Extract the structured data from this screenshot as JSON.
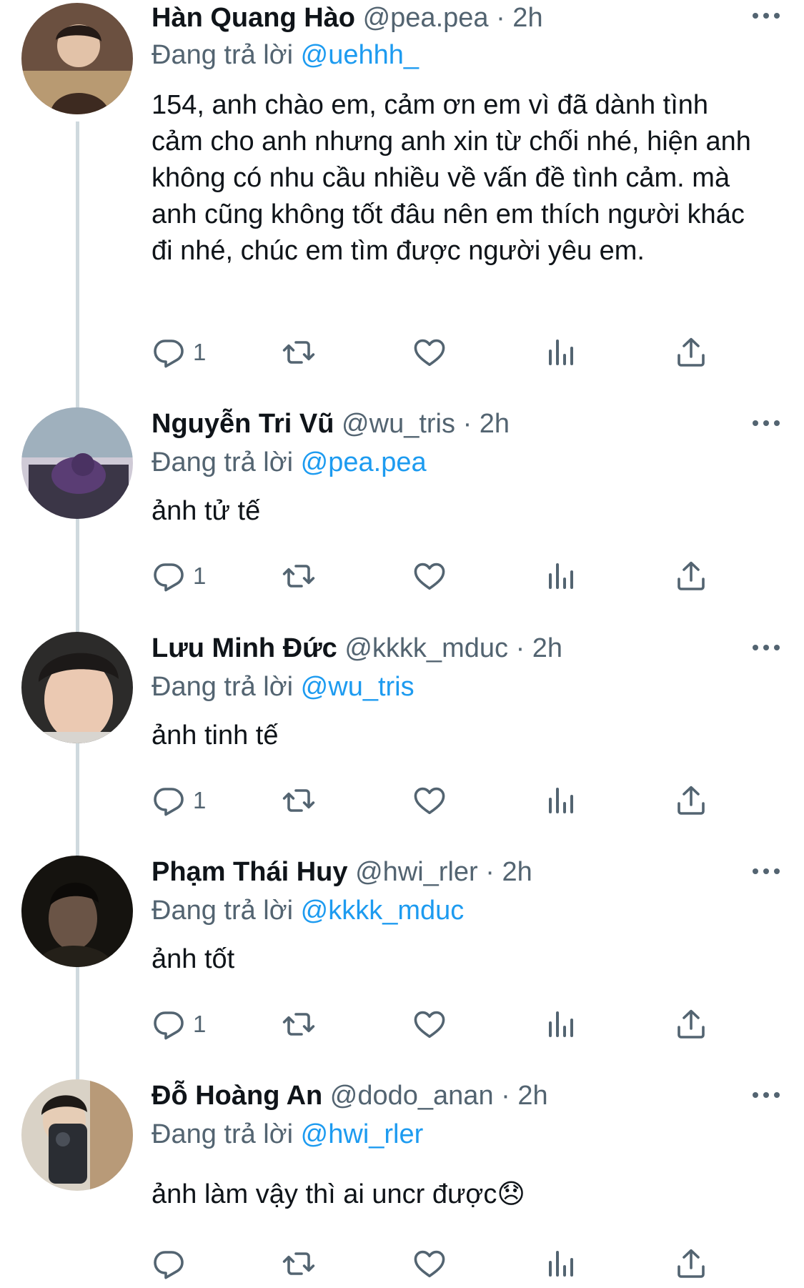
{
  "tweets": [
    {
      "name": "Hàn Quang Hào",
      "handle": "@pea.pea",
      "time": "· 2h",
      "replying_prefix": "Đang trả lời",
      "replying_to": "@uehhh_",
      "text": "154, anh chào em, cảm ơn em vì đã dành tình cảm cho anh nhưng anh xin từ chối nhé, hiện anh không có nhu cầu nhiều về vấn đề tình cảm. mà anh cũng không tốt đâu nên em thích người khác đi nhé, chúc em tìm được người yêu em.",
      "reply_count": "1"
    },
    {
      "name": "Nguyễn Tri Vũ",
      "handle": "@wu_tris",
      "time": "· 2h",
      "replying_prefix": "Đang trả lời",
      "replying_to": "@pea.pea",
      "text": "ảnh tử tế",
      "reply_count": "1"
    },
    {
      "name": "Lưu Minh Đức",
      "handle": "@kkkk_mduc",
      "time": "· 2h",
      "replying_prefix": "Đang trả lời",
      "replying_to": "@wu_tris",
      "text": "ảnh tinh tế",
      "reply_count": "1"
    },
    {
      "name": "Phạm Thái Huy",
      "handle": "@hwi_rler",
      "time": "· 2h",
      "replying_prefix": "Đang trả lời",
      "replying_to": "@kkkk_mduc",
      "text": "ảnh tốt",
      "reply_count": "1"
    },
    {
      "name": "Đỗ Hoàng An",
      "handle": "@dodo_anan",
      "time": "· 2h",
      "replying_prefix": "Đang trả lời",
      "replying_to": "@hwi_rler",
      "text": "ảnh làm vậy thì ai uncr được😞",
      "reply_count": ""
    }
  ],
  "colors": {
    "accent": "#1d9bf0",
    "secondary": "#536471",
    "thread_line": "#cfd9de"
  },
  "icons": [
    "reply-icon",
    "retweet-icon",
    "like-icon",
    "views-icon",
    "share-icon",
    "more-icon"
  ]
}
